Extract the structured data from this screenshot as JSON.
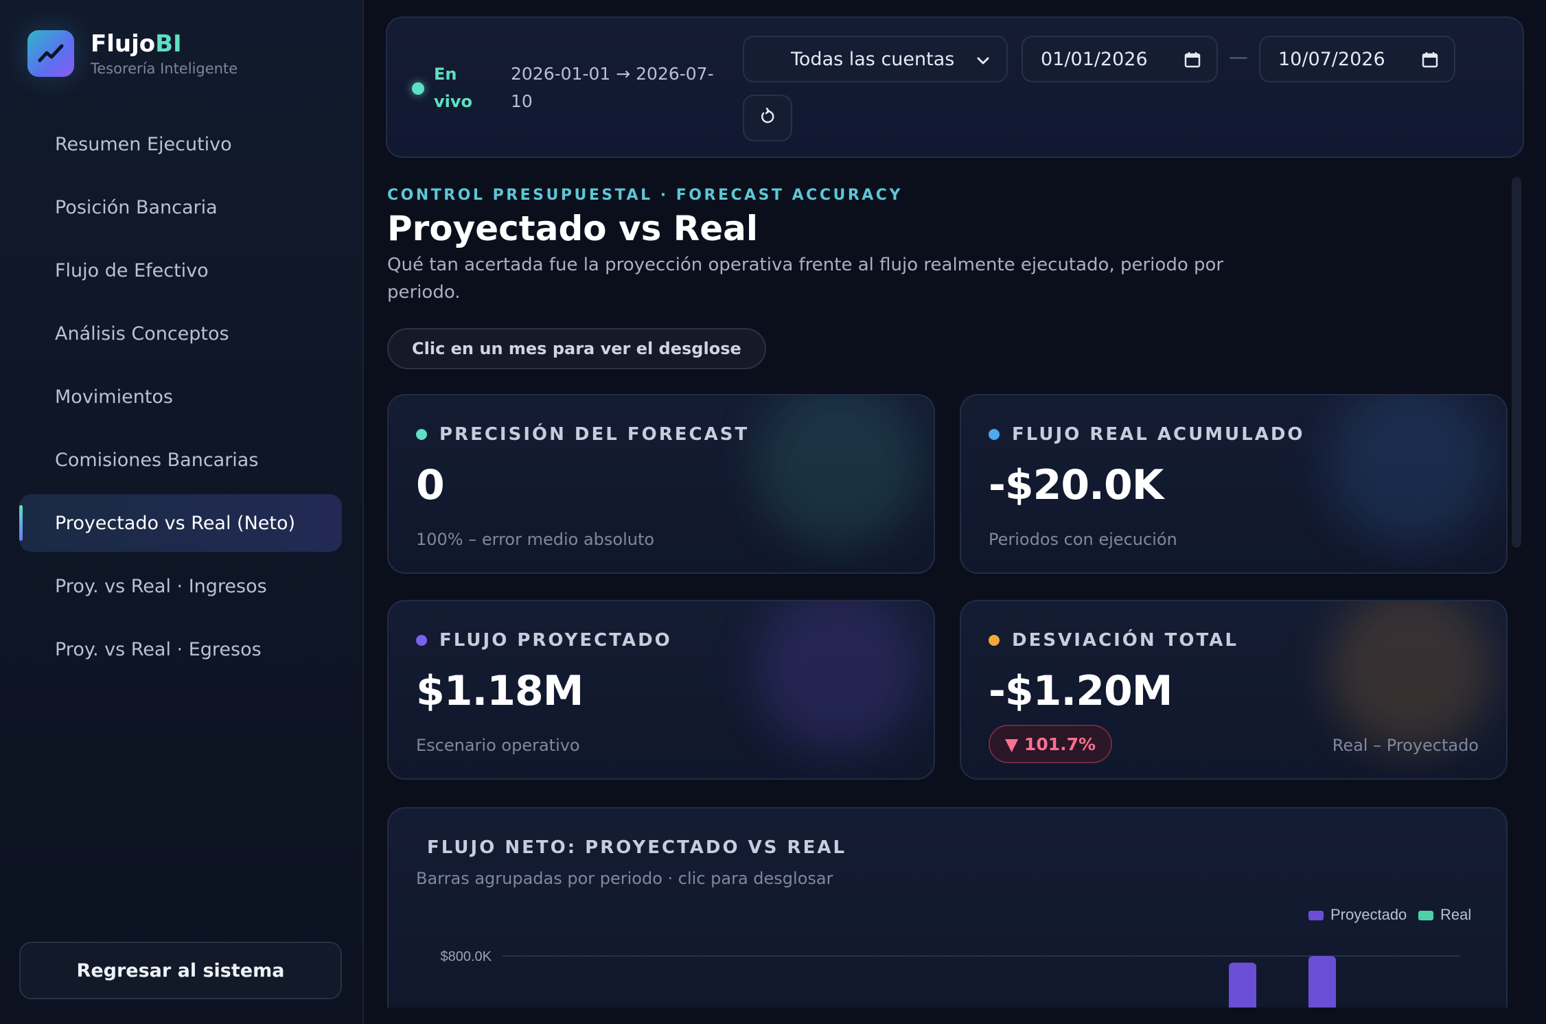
{
  "brand": {
    "name_main": "Flujo",
    "name_accent": "BI",
    "subtitle": "Tesorería Inteligente",
    "icon": "trending-up-icon"
  },
  "sidebar": {
    "items": [
      {
        "label": "Resumen Ejecutivo",
        "active": false
      },
      {
        "label": "Posición Bancaria",
        "active": false
      },
      {
        "label": "Flujo de Efectivo",
        "active": false
      },
      {
        "label": "Análisis Conceptos",
        "active": false
      },
      {
        "label": "Movimientos",
        "active": false
      },
      {
        "label": "Comisiones Bancarias",
        "active": false
      },
      {
        "label": "Proyectado vs Real (Neto)",
        "active": true
      },
      {
        "label": "Proy. vs Real · Ingresos",
        "active": false
      },
      {
        "label": "Proy. vs Real · Egresos",
        "active": false
      }
    ],
    "back_button": "Regresar al sistema"
  },
  "topbar": {
    "live_label": "En vivo",
    "range_label": "2026-01-01 → 2026-07-10",
    "account_select": "Todas las cuentas",
    "date_from": "01/01/2026",
    "date_to": "10/07/2026",
    "separator": "—",
    "reset_icon": "reset-icon",
    "calendar_icon": "calendar-icon",
    "dropdown_icon": "chevron-down-icon"
  },
  "header": {
    "eyebrow": "CONTROL PRESUPUESTAL · FORECAST ACCURACY",
    "title": "Proyectado vs Real",
    "description": "Qué tan acertada fue la proyección operativa frente al flujo realmente ejecutado, periodo por periodo.",
    "hint": "Clic en un mes para ver el desglose"
  },
  "kpis": {
    "precision": {
      "label": "PRECISIÓN DEL FORECAST",
      "value": "0",
      "foot": "100% – error medio absoluto",
      "color": "#5ee0c3"
    },
    "real": {
      "label": "FLUJO REAL ACUMULADO",
      "value": "-$20.0K",
      "foot": "Periodos con ejecución",
      "color": "#4fa8f0"
    },
    "projected": {
      "label": "FLUJO PROYECTADO",
      "value": "$1.18M",
      "foot": "Escenario operativo",
      "color": "#7b61f0"
    },
    "deviation": {
      "label": "DESVIACIÓN TOTAL",
      "value": "-$1.20M",
      "badge": "▼ 101.7%",
      "foot": "Real – Proyectado",
      "color": "#f2a93b"
    }
  },
  "chart_panel": {
    "title": "FLUJO NETO: PROYECTADO VS REAL",
    "subtitle": "Barras agrupadas por periodo · clic para desglosar"
  },
  "chart_data": {
    "type": "bar",
    "title": "FLUJO NETO: PROYECTADO VS REAL",
    "legend": [
      "Proyectado",
      "Real"
    ],
    "legend_position": "top-right",
    "colors": {
      "Proyectado": "#6a4fd6",
      "Real": "#4fcfa8"
    },
    "y_tick_labels": [
      "$800.0K"
    ],
    "y_ticks": [
      800000
    ],
    "grid": true,
    "series": [
      {
        "name": "Proyectado",
        "visible_bar_tops": [
          780000,
          800000
        ]
      }
    ]
  }
}
